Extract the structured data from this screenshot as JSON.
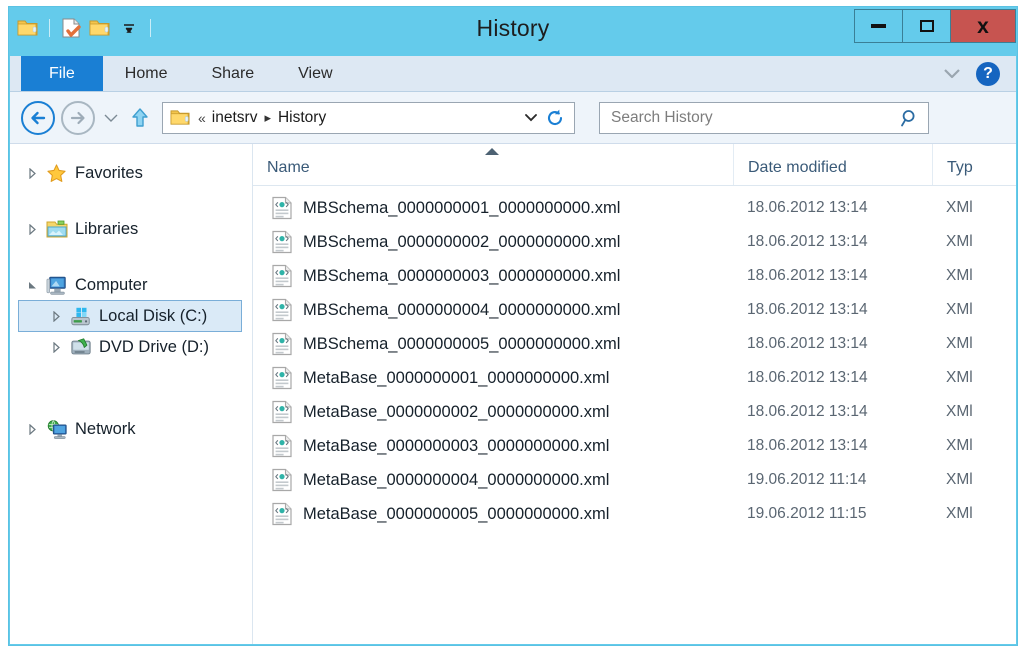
{
  "window": {
    "title": "History",
    "quick_access": [
      {
        "name": "folder-icon",
        "label": "Folder"
      },
      {
        "name": "properties-icon",
        "label": "Properties"
      },
      {
        "name": "new-folder-icon",
        "label": "New folder"
      },
      {
        "name": "chevron-down-icon",
        "label": "Customize Quick Access Toolbar"
      }
    ],
    "controls": {
      "minimize": "Minimize",
      "maximize": "Maximize",
      "close": "x"
    },
    "colors": {
      "frame": "#64cbeb",
      "close": "#c75450",
      "file_tab": "#1a7fd4",
      "ribbon": "#dde8f3",
      "selection": "#daeaf7"
    }
  },
  "ribbon": {
    "tabs": [
      {
        "label": "File",
        "active": true
      },
      {
        "label": "Home",
        "active": false
      },
      {
        "label": "Share",
        "active": false
      },
      {
        "label": "View",
        "active": false
      }
    ],
    "expand_label": "Expand the Ribbon",
    "help_label": "?"
  },
  "navigation": {
    "back_label": "Back",
    "forward_label": "Forward",
    "recent_label": "Recent locations",
    "up_label": "Up one level",
    "address": {
      "overflow": "«",
      "crumbs": [
        "inetsrv",
        "History"
      ],
      "separator": "▸",
      "dropdown": "Previous Locations",
      "refresh": "Refresh"
    },
    "search": {
      "placeholder": "Search History",
      "value": ""
    }
  },
  "sidebar": {
    "items": [
      {
        "label": "Favorites",
        "icon": "star-icon",
        "expander": "collapsed",
        "indent": 0,
        "selected": false
      },
      {
        "label": "Libraries",
        "icon": "library-icon",
        "expander": "collapsed",
        "indent": 0,
        "selected": false
      },
      {
        "label": "Computer",
        "icon": "computer-icon",
        "expander": "expanded",
        "indent": 0,
        "selected": false
      },
      {
        "label": "Local Disk (C:)",
        "icon": "harddrive-icon",
        "expander": "collapsed",
        "indent": 1,
        "selected": true
      },
      {
        "label": "DVD Drive (D:)",
        "icon": "dvd-icon",
        "expander": "collapsed",
        "indent": 1,
        "selected": false
      },
      {
        "label": "Network",
        "icon": "network-icon",
        "expander": "collapsed",
        "indent": 0,
        "selected": false
      }
    ]
  },
  "filelist": {
    "columns": [
      {
        "label": "Name",
        "sorted": "asc"
      },
      {
        "label": "Date modified",
        "sorted": null
      },
      {
        "label": "Typ",
        "sorted": null
      }
    ],
    "rows": [
      {
        "name": "MBSchema_0000000001_0000000000.xml",
        "date": "18.06.2012 13:14",
        "type": "XMl",
        "icon": "xml-file-icon"
      },
      {
        "name": "MBSchema_0000000002_0000000000.xml",
        "date": "18.06.2012 13:14",
        "type": "XMl",
        "icon": "xml-file-icon"
      },
      {
        "name": "MBSchema_0000000003_0000000000.xml",
        "date": "18.06.2012 13:14",
        "type": "XMl",
        "icon": "xml-file-icon"
      },
      {
        "name": "MBSchema_0000000004_0000000000.xml",
        "date": "18.06.2012 13:14",
        "type": "XMl",
        "icon": "xml-file-icon"
      },
      {
        "name": "MBSchema_0000000005_0000000000.xml",
        "date": "18.06.2012 13:14",
        "type": "XMl",
        "icon": "xml-file-icon"
      },
      {
        "name": "MetaBase_0000000001_0000000000.xml",
        "date": "18.06.2012 13:14",
        "type": "XMl",
        "icon": "xml-file-icon"
      },
      {
        "name": "MetaBase_0000000002_0000000000.xml",
        "date": "18.06.2012 13:14",
        "type": "XMl",
        "icon": "xml-file-icon"
      },
      {
        "name": "MetaBase_0000000003_0000000000.xml",
        "date": "18.06.2012 13:14",
        "type": "XMl",
        "icon": "xml-file-icon"
      },
      {
        "name": "MetaBase_0000000004_0000000000.xml",
        "date": "19.06.2012 11:14",
        "type": "XMl",
        "icon": "xml-file-icon"
      },
      {
        "name": "MetaBase_0000000005_0000000000.xml",
        "date": "19.06.2012 11:15",
        "type": "XMl",
        "icon": "xml-file-icon"
      }
    ]
  }
}
